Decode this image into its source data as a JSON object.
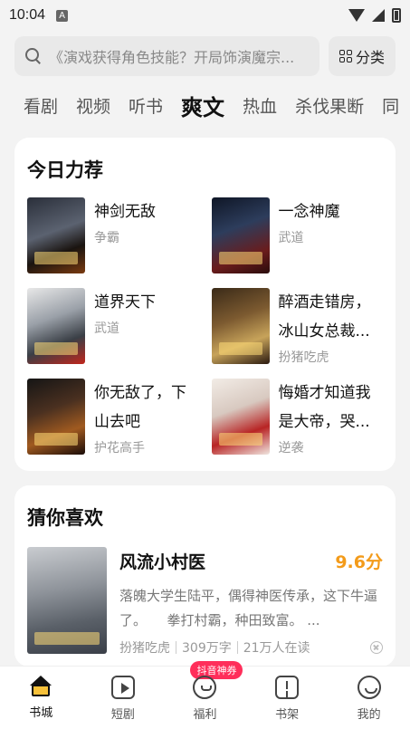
{
  "status_bar": {
    "time": "10:04",
    "notification_badge": "A"
  },
  "search": {
    "placeholder": "《演戏获得角色技能？开局饰演魔宗..."
  },
  "category_button": {
    "label": "分类"
  },
  "tabs": [
    {
      "label": "看剧",
      "active": false
    },
    {
      "label": "视频",
      "active": false
    },
    {
      "label": "听书",
      "active": false
    },
    {
      "label": "爽文",
      "active": true
    },
    {
      "label": "热血",
      "active": false
    },
    {
      "label": "杀伐果断",
      "active": false
    },
    {
      "label": "同",
      "active": false
    }
  ],
  "today_recommend": {
    "title": "今日力荐",
    "items": [
      {
        "title": "神剑无敌",
        "author": "争霸"
      },
      {
        "title": "一念神魔",
        "author": "武道"
      },
      {
        "title": "道界天下",
        "author": "武道"
      },
      {
        "title": "醉酒走错房，冰山女总裁...",
        "author": "扮猪吃虎"
      },
      {
        "title": "你无敌了，下山去吧",
        "author": "护花高手"
      },
      {
        "title": "悔婚才知道我是大帝，哭...",
        "author": "逆袭"
      }
    ]
  },
  "guess": {
    "title": "猜你喜欢",
    "book": {
      "title": "风流小村医",
      "score": "9.6分",
      "desc": "落魄大学生陆平，偶得神医传承，这下牛逼了。　　拳打村霸，种田致富。 ...",
      "author": "扮猪吃虎",
      "words": "309万字",
      "readers": "21万人在读"
    }
  },
  "bottom_nav": [
    {
      "label": "书城",
      "icon": "home-icon",
      "active": true
    },
    {
      "label": "短剧",
      "icon": "video-icon",
      "active": false
    },
    {
      "label": "福利",
      "icon": "gift-icon",
      "active": false,
      "badge": "抖音神券"
    },
    {
      "label": "书架",
      "icon": "bookshelf-icon",
      "active": false
    },
    {
      "label": "我的",
      "icon": "profile-icon",
      "active": false
    }
  ],
  "colors": {
    "accent_score": "#f39b1a",
    "badge": "#ff2e5a",
    "home_icon_fill": "#f7c13a"
  }
}
